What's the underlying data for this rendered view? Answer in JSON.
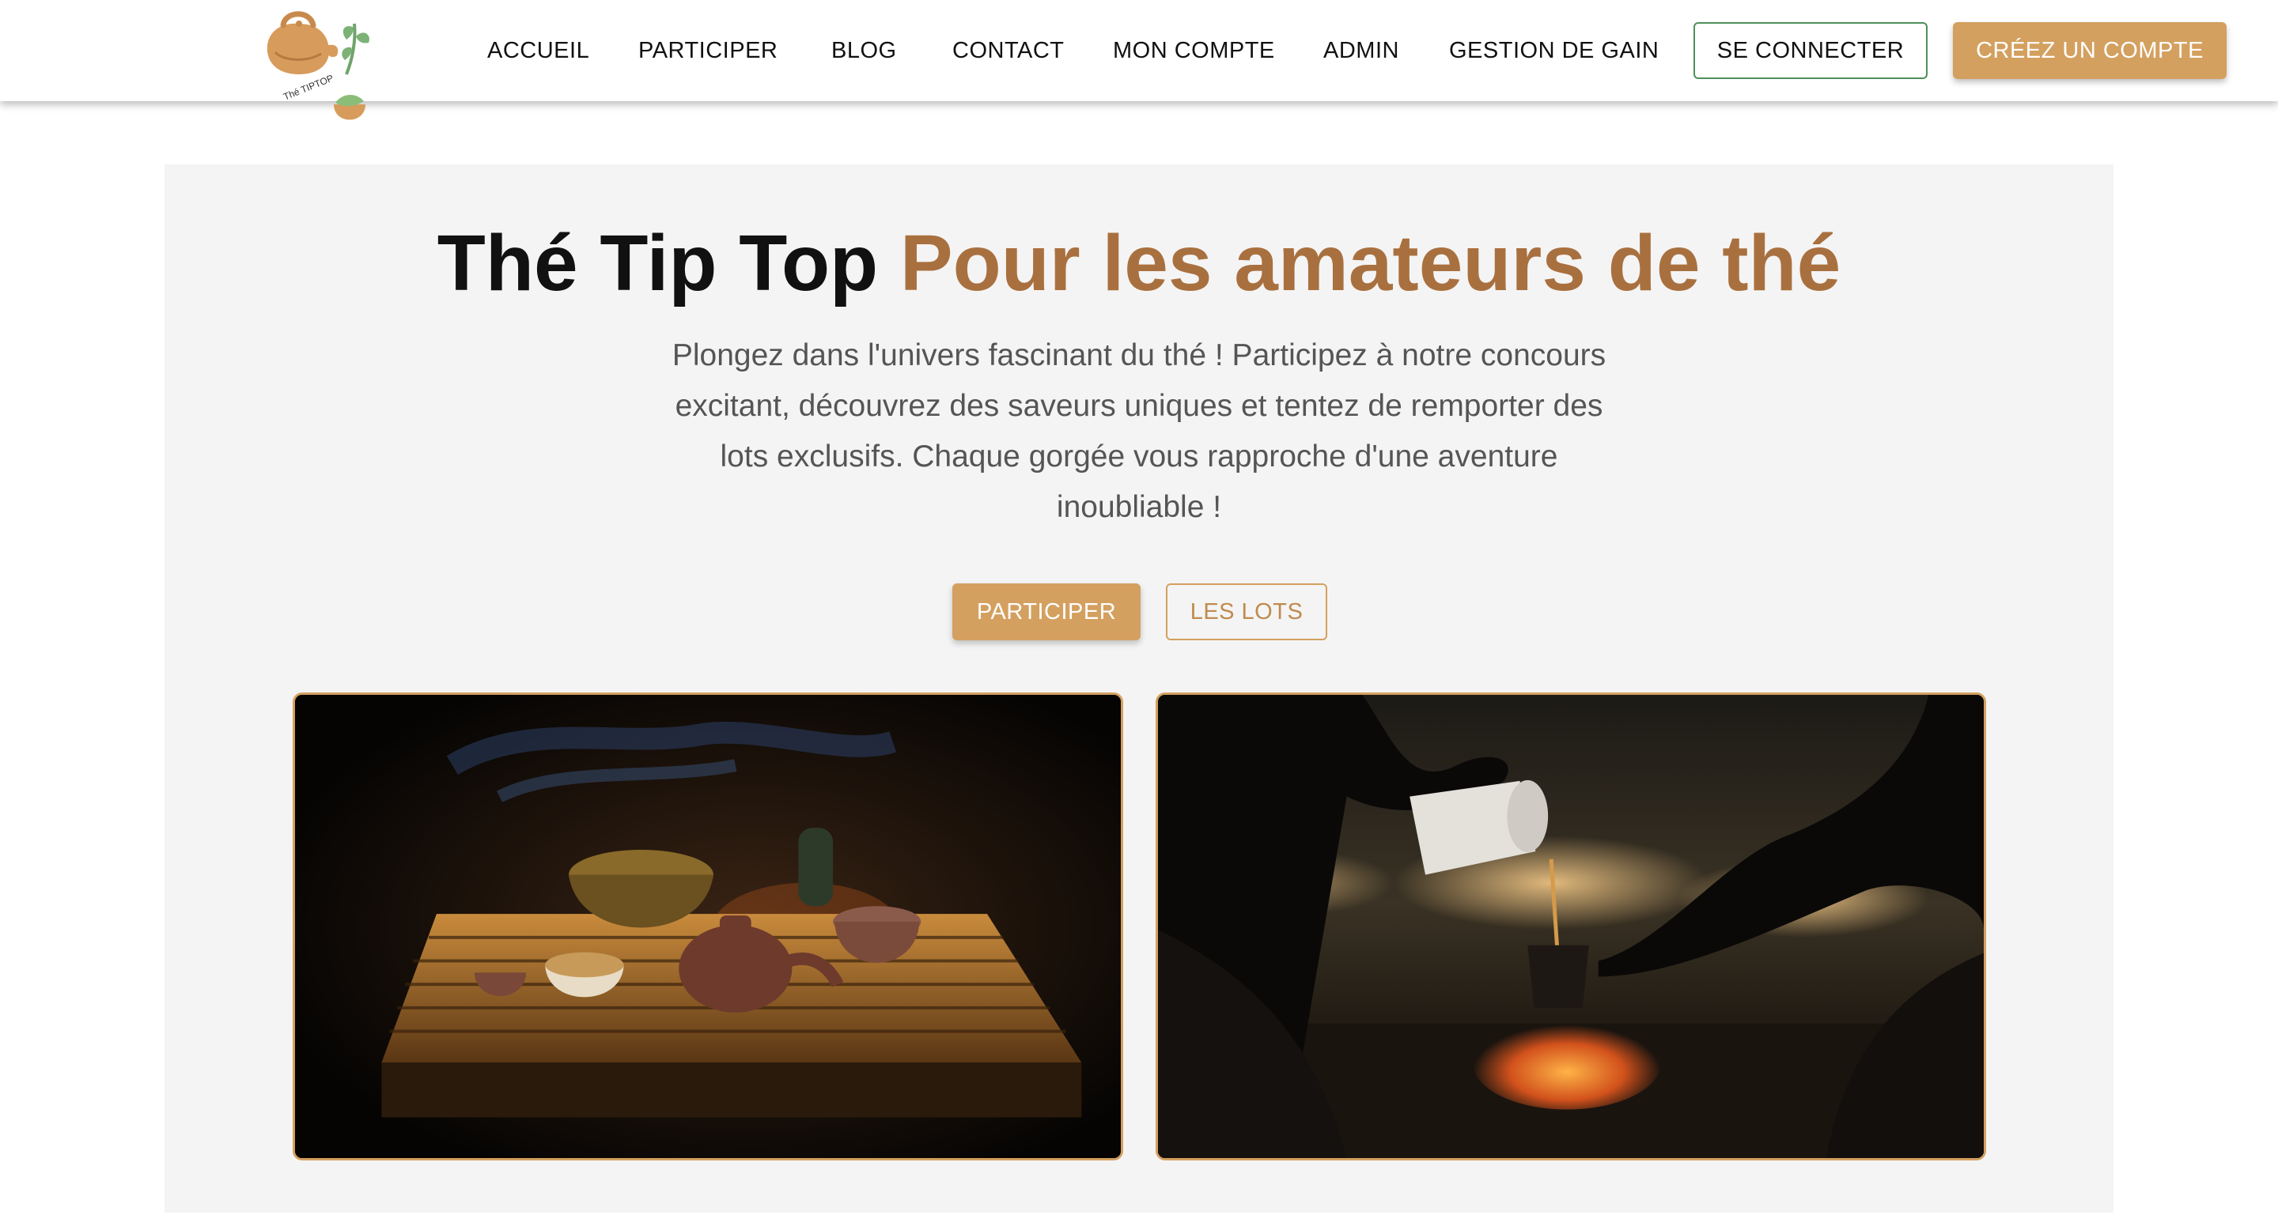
{
  "logo": {
    "text": "Thé TIPTOP",
    "icon": "teapot-leaf-logo"
  },
  "nav": {
    "items": [
      {
        "label": "ACCUEIL"
      },
      {
        "label": "PARTICIPER"
      },
      {
        "label": "BLOG"
      },
      {
        "label": "CONTACT"
      },
      {
        "label": "MON COMPTE"
      },
      {
        "label": "ADMIN"
      },
      {
        "label": "GESTION DE GAIN"
      }
    ],
    "login_label": "SE CONNECTER",
    "signup_label": "CRÉEZ UN COMPTE"
  },
  "hero": {
    "title_main": "Thé Tip Top",
    "title_accent": "Pour les amateurs de thé",
    "description": "Plongez dans l'univers fascinant du thé ! Participez à notre concours excitant, découvrez des saveurs uniques et tentez de remporter des lots exclusifs. Chaque gorgée vous rapproche d'une aventure inoubliable !",
    "participate_label": "PARTICIPER",
    "lots_label": "LES LOTS"
  },
  "images": [
    {
      "name": "tea-ceremony-photo"
    },
    {
      "name": "campfire-tea-pouring-photo"
    }
  ],
  "colors": {
    "brand_gold": "#d4a05f",
    "title_accent": "#a9703f",
    "login_border": "#4f8f5a",
    "hero_background": "#f4f4f4"
  }
}
